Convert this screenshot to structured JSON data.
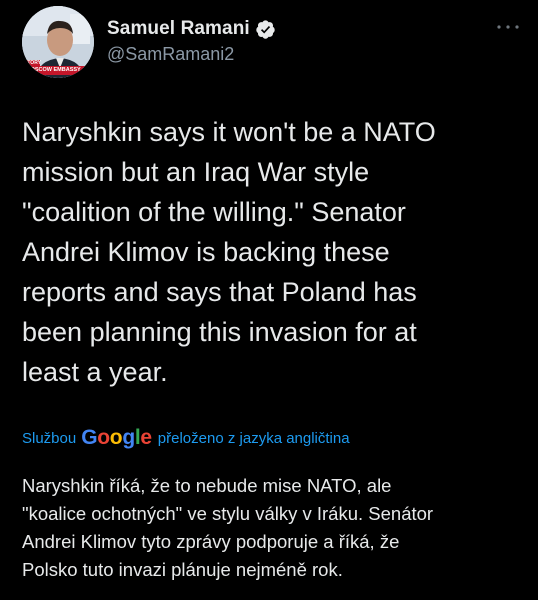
{
  "author": {
    "display_name": "Samuel Ramani",
    "handle": "@SamRamani2",
    "verified": true,
    "avatar_caption": "MOSCOW EMBASSY",
    "avatar_tag": "STORY"
  },
  "tweet": {
    "text": "Naryshkin says it won't be a NATO\nmission but an Iraq War style\n\"coalition of the willing.\" Senator\nAndrei Klimov is backing these\nreports and says that Poland has\nbeen planning this invasion for at\nleast a year."
  },
  "translation": {
    "prefix": "Službou",
    "provider_logo": "Google",
    "suffix": "přeloženo z jazyka angličtina",
    "text": "Naryshkin říká, že to nebude mise NATO, ale\n\"koalice ochotných\" ve stylu války v Iráku. Senátor\nAndrei Klimov tyto zprávy podporuje a říká, že\nPolsko tuto invazi plánuje nejméně rok."
  },
  "icons": {
    "verified": "verified-badge-icon",
    "more": "more-options-icon"
  },
  "colors": {
    "background": "#000000",
    "text_primary": "#e7e9ea",
    "text_secondary": "#8b98a5",
    "link": "#1d9bf0"
  }
}
